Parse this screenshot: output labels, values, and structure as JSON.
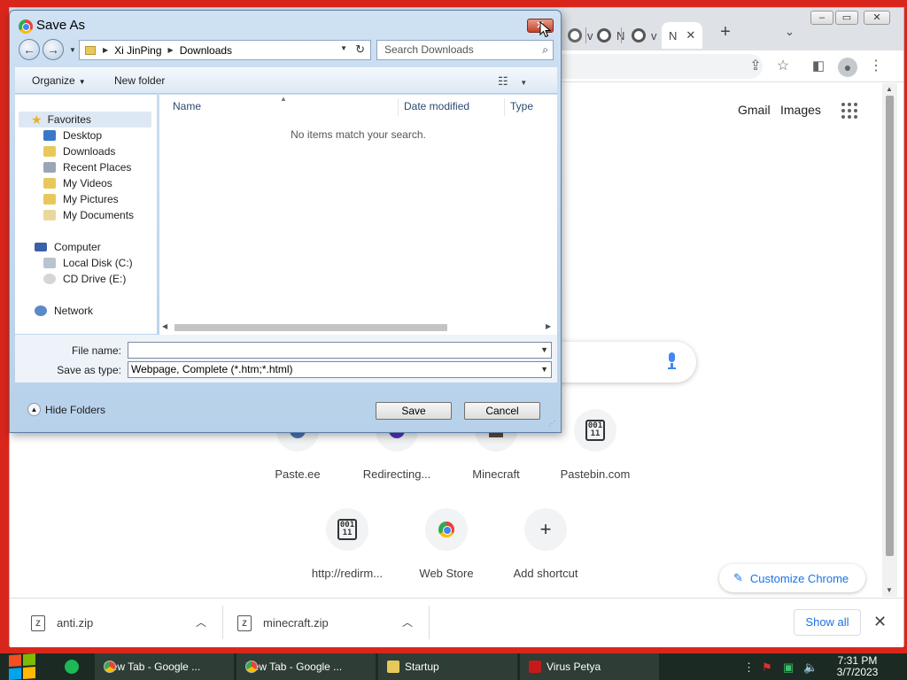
{
  "browser": {
    "tabs": [
      {
        "label": "v"
      },
      {
        "label": "N"
      },
      {
        "label": "v"
      },
      {
        "label": "N"
      }
    ],
    "new_tab_symbol": "+",
    "tab_search_symbol": "⌄",
    "window_controls": [
      "–",
      "▭",
      "✕"
    ],
    "ntp": {
      "header_links": [
        "Gmail",
        "Images"
      ],
      "shortcuts_row1": [
        {
          "label": "Paste.ee",
          "icon": "paste-ee-icon"
        },
        {
          "label": "Redirecting...",
          "icon": "redirect-icon"
        },
        {
          "label": "Minecraft",
          "icon": "minecraft-icon"
        },
        {
          "label": "Pastebin.com",
          "icon": "binary-icon",
          "glyph": "001\n11"
        }
      ],
      "shortcuts_row2": [
        {
          "label": "http://redirm...",
          "icon": "binary-icon",
          "glyph": "001\n11"
        },
        {
          "label": "Web Store",
          "icon": "chrome-logo-icon"
        },
        {
          "label": "Add shortcut",
          "icon": "plus-icon",
          "glyph": "+"
        }
      ],
      "customize_label": "Customize Chrome"
    },
    "downloads": {
      "items": [
        {
          "name": "anti.zip"
        },
        {
          "name": "minecraft.zip"
        }
      ],
      "show_all_label": "Show all"
    }
  },
  "dialog": {
    "title": "Save As",
    "breadcrumb": [
      "Xi JinPing",
      "Downloads"
    ],
    "search_placeholder": "Search Downloads",
    "commands": {
      "organize": "Organize",
      "new_folder": "New folder"
    },
    "nav": {
      "favorites": "Favorites",
      "favorites_items": [
        "Desktop",
        "Downloads",
        "Recent Places",
        "My Videos",
        "My Pictures",
        "My Documents"
      ],
      "computer": "Computer",
      "computer_items": [
        "Local Disk (C:)",
        "CD Drive (E:)"
      ],
      "network": "Network"
    },
    "columns": {
      "name": "Name",
      "date_modified": "Date modified",
      "type": "Type"
    },
    "empty_message": "No items match your search.",
    "file_name_label": "File name:",
    "file_name_value": "",
    "save_type_label": "Save as type:",
    "save_type_value": "Webpage, Complete (*.htm;*.html)",
    "hide_folders_label": "Hide Folders",
    "save_label": "Save",
    "cancel_label": "Cancel"
  },
  "taskbar": {
    "items": [
      {
        "label": "New Tab - Google ...",
        "icon": "chrome-icon"
      },
      {
        "label": "New Tab - Google ...",
        "icon": "chrome-icon"
      },
      {
        "label": "Startup",
        "icon": "folder-icon"
      },
      {
        "label": "Virus Petya",
        "icon": "petya-icon"
      }
    ],
    "time": "7:31 PM",
    "date": "3/7/2023"
  }
}
